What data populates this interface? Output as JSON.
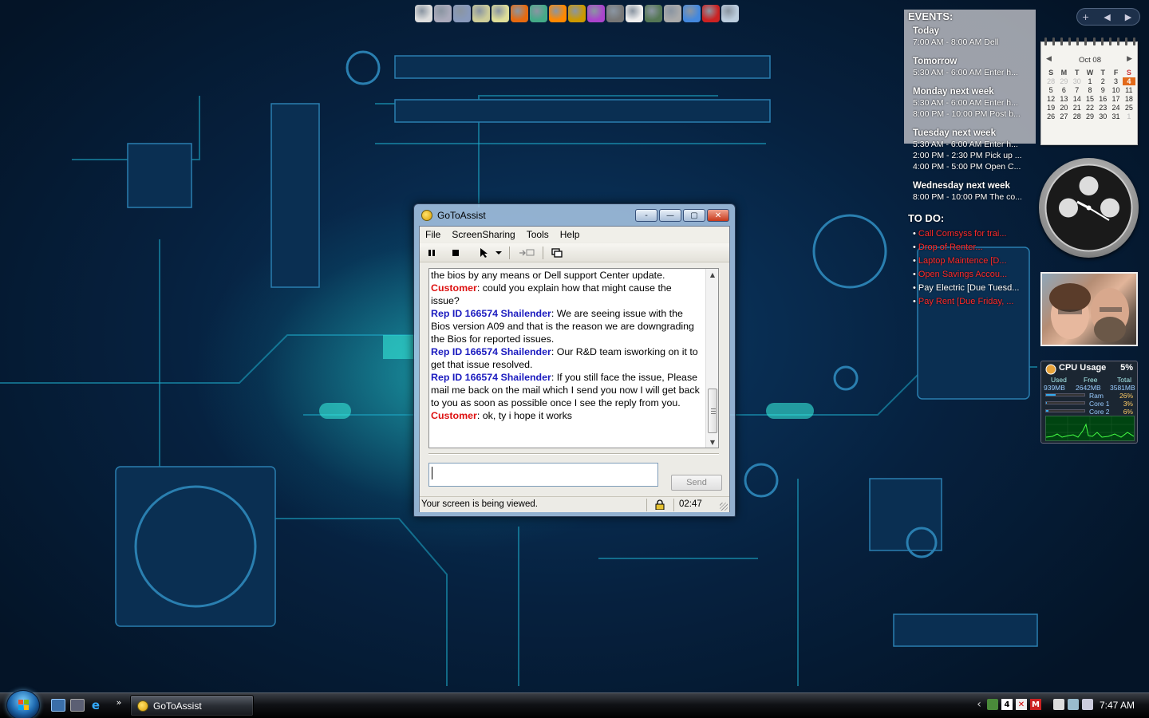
{
  "window": {
    "title": "GoToAssist",
    "controls": {
      "minimize_tiny": "-",
      "minimize": "—",
      "maximize": "▢",
      "close": "✕"
    },
    "menu": [
      "File",
      "ScreenSharing",
      "Tools",
      "Help"
    ],
    "chat": [
      {
        "speaker": "",
        "text": "the bios by any means or Dell support Center update.",
        "type": "cont"
      },
      {
        "speaker": "Customer",
        "text": ": could you explain how that might cause the issue?",
        "type": "cust"
      },
      {
        "speaker": "Rep ID 166574 Shailender",
        "text": ": We are seeing issue with the Bios version A09 and that is the reason we are downgrading the Bios for reported issues.",
        "type": "rep"
      },
      {
        "speaker": "Rep ID 166574 Shailender",
        "text": ": Our R&D team isworking on it to get that issue resolved.",
        "type": "rep"
      },
      {
        "speaker": "Rep ID 166574 Shailender",
        "text": ": If you still face the issue, Please mail me back on the mail which I send you now I will get back to you as soon as possible once I see the reply from you.",
        "type": "rep"
      },
      {
        "speaker": "Customer",
        "text": ": ok, ty i hope it works",
        "type": "cust"
      }
    ],
    "input_value": "",
    "send_label": "Send",
    "status_text": "Your screen is being viewed.",
    "session_time": "02:47"
  },
  "events": {
    "title": "EVENTS:",
    "days": [
      {
        "label": "Today",
        "items": [
          "7:00 AM - 8:00 AM Dell"
        ]
      },
      {
        "label": "Tomorrow",
        "items": [
          "5:30 AM - 6:00 AM Enter h..."
        ]
      },
      {
        "label": "Monday next week",
        "items": [
          "5:30 AM - 6:00 AM Enter h...",
          "8:00 PM - 10:00 PM Post b..."
        ]
      },
      {
        "label": "Tuesday next week",
        "items": [
          "5:30 AM - 6:00 AM Enter h...",
          "2:00 PM - 2:30 PM Pick up ...",
          "4:00 PM - 5:00 PM Open C..."
        ]
      },
      {
        "label": "Wednesday next week",
        "items": [
          "8:00 PM - 10:00 PM The co..."
        ]
      }
    ]
  },
  "todo": {
    "title": "TO DO:",
    "items": [
      {
        "text": "Call Comsyss for trai...",
        "color": "#ff2a2a"
      },
      {
        "text": "Drop of Renter...",
        "color": "#ff2a2a"
      },
      {
        "text": "Laptop Maintence [D...",
        "color": "#ff2a2a"
      },
      {
        "text": "Open Savings Accou...",
        "color": "#ff2a2a"
      },
      {
        "text": "Pay Electric [Due Tuesd...",
        "color": "#ffffff"
      },
      {
        "text": "Pay Rent [Due Friday, ...",
        "color": "#ff2a2a"
      }
    ]
  },
  "calendar": {
    "month": "Oct 08",
    "prev": "◀",
    "next": "▶",
    "weekdays": [
      "S",
      "M",
      "T",
      "W",
      "T",
      "F",
      "S"
    ],
    "lead_days": [
      "28",
      "29",
      "30"
    ],
    "days": [
      "1",
      "2",
      "3",
      "4",
      "5",
      "6",
      "7",
      "8",
      "9",
      "10",
      "11",
      "12",
      "13",
      "14",
      "15",
      "16",
      "17",
      "18",
      "19",
      "20",
      "21",
      "22",
      "23",
      "24",
      "25",
      "26",
      "27",
      "28",
      "29",
      "30",
      "31"
    ],
    "trail_days": [
      "1"
    ],
    "today": "4"
  },
  "cpu": {
    "title": "CPU Usage",
    "percent": "5%",
    "used_label": "Used",
    "free_label": "Free",
    "total_label": "Total",
    "used": "939MB",
    "free": "2642MB",
    "total": "3581MB",
    "rows": [
      {
        "label": "Ram",
        "value": "26%",
        "level": 0.26
      },
      {
        "label": "Core 1",
        "value": "3%",
        "level": 0.03
      },
      {
        "label": "Core 2",
        "value": "6%",
        "level": 0.06
      }
    ]
  },
  "sidebar_toolbar": {
    "add": "+",
    "prev": "◀",
    "next": "▶"
  },
  "taskbar": {
    "task_label": "GoToAssist",
    "quicklaunch_more": "»",
    "tray_arrow": "‹",
    "clock": "7:47 AM"
  },
  "colors": {
    "rep_name": "#1b1bbf",
    "customer_name": "#d11111",
    "calendar_today": "#e26a1b"
  }
}
